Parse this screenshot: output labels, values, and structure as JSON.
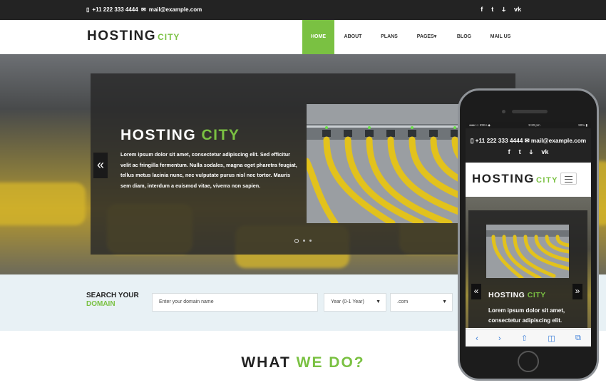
{
  "topbar": {
    "phone_icon": "phone-icon",
    "phone": "+11 222 333 4444",
    "mail_icon": "envelope-icon",
    "email": "mail@example.com",
    "social": [
      "facebook-icon",
      "twitter-icon",
      "rss-icon",
      "vk-icon"
    ]
  },
  "logo": {
    "main": "HOSTING",
    "accent": "CITY"
  },
  "nav": {
    "items": [
      {
        "label": "HOME",
        "active": true
      },
      {
        "label": "ABOUT"
      },
      {
        "label": "PLANS"
      },
      {
        "label": "PAGES▾"
      },
      {
        "label": "BLOG"
      },
      {
        "label": "MAIL US"
      }
    ]
  },
  "slider": {
    "title_main": "HOSTING",
    "title_accent": "CITY",
    "text": "Lorem ipsum dolor sit amet, consectetur adipiscing elit. Sed efficitur velit ac fringilla fermentum. Nulla sodales, magna eget pharetra feugiat, tellus metus lacinia nunc, nec vulputate purus nisl nec tortor. Mauris sem diam, interdum a euismod vitae, viverra non sapien.",
    "prev_label": "«",
    "dots": 3
  },
  "search": {
    "label_line1": "SEARCH YOUR",
    "label_line2": "DOMAIN",
    "domain_placeholder": "Enter your domain name",
    "year_value": "Year (0-1 Year)",
    "tld_value": ".com"
  },
  "section": {
    "title_main": "WHAT",
    "title_accent": "WE DO?"
  },
  "phone": {
    "status_left": "●●●○○ IDEA ◆",
    "time": "9:20 pm",
    "battery": "90% ▮",
    "phone": "+11 222 333 4444",
    "email": "mail@example.com",
    "logo_main": "HOSTING",
    "logo_accent": "CITY",
    "slide_title_main": "HOSTING",
    "slide_title_accent": "CITY",
    "slide_text": "Lorem ipsum dolor sit amet, consectetur adipiscing elit. Sed efficitur",
    "prev_label": "«",
    "next_label": "»",
    "toolbar": [
      "back-icon",
      "forward-icon",
      "share-icon",
      "bookmarks-icon",
      "tabs-icon"
    ]
  },
  "colors": {
    "accent": "#7ac142",
    "dark": "#232323",
    "search_bg": "#e8f1f5"
  }
}
